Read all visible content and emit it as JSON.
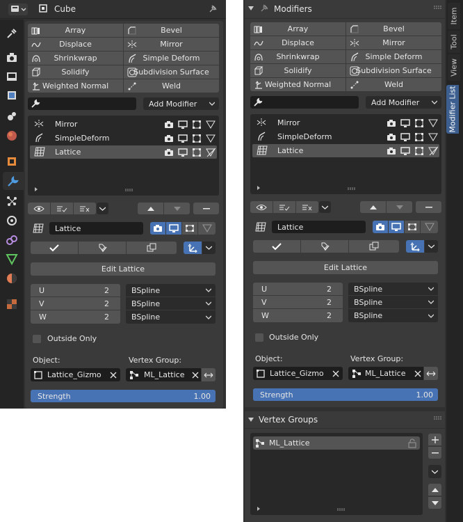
{
  "left": {
    "header_title": "Cube",
    "modifier_buttons": [
      {
        "label": "Array",
        "icon": "array-icon"
      },
      {
        "label": "Bevel",
        "icon": "bevel-icon"
      },
      {
        "label": "Displace",
        "icon": "displace-icon"
      },
      {
        "label": "Mirror",
        "icon": "mirror-icon"
      },
      {
        "label": "Shrinkwrap",
        "icon": "shrinkwrap-icon"
      },
      {
        "label": "Simple Deform",
        "icon": "simple-deform-icon"
      },
      {
        "label": "Solidify",
        "icon": "solidify-icon"
      },
      {
        "label": "Subdivision Surface",
        "icon": "subsurf-icon"
      },
      {
        "label": "Weighted Normal",
        "icon": "weighted-normal-icon"
      },
      {
        "label": "Weld",
        "icon": "weld-icon"
      }
    ],
    "search_value": "",
    "add_modifier": "Add Modifier",
    "stack": [
      "Mirror",
      "SimpleDeform",
      "Lattice"
    ],
    "active_name": "Lattice",
    "edit_lattice": "Edit Lattice",
    "u_label": "U",
    "u_value": "2",
    "u_interp": "BSpline",
    "v_label": "V",
    "v_value": "2",
    "v_interp": "BSpline",
    "w_label": "W",
    "w_value": "2",
    "w_interp": "BSpline",
    "outside_only": "Outside Only",
    "object_label": "Object:",
    "object_value": "Lattice_Gizmo",
    "vgroup_label": "Vertex Group:",
    "vgroup_value": "ML_Lattice",
    "strength_label": "Strength",
    "strength_value": "1.00",
    "strength_fraction": 1.0
  },
  "right": {
    "header_title": "Modifiers",
    "modifier_buttons": [
      {
        "label": "Array",
        "icon": "array-icon"
      },
      {
        "label": "Bevel",
        "icon": "bevel-icon"
      },
      {
        "label": "Displace",
        "icon": "displace-icon"
      },
      {
        "label": "Mirror",
        "icon": "mirror-icon"
      },
      {
        "label": "Shrinkwrap",
        "icon": "shrinkwrap-icon"
      },
      {
        "label": "Simple Deform",
        "icon": "simple-deform-icon"
      },
      {
        "label": "Solidify",
        "icon": "solidify-icon"
      },
      {
        "label": "Subdivision Surface",
        "icon": "subsurf-icon"
      },
      {
        "label": "Weighted Normal",
        "icon": "weighted-normal-icon"
      },
      {
        "label": "Weld",
        "icon": "weld-icon"
      }
    ],
    "search_value": "",
    "add_modifier": "Add Modifier",
    "stack": [
      "Mirror",
      "SimpleDeform",
      "Lattice"
    ],
    "active_name": "Lattice",
    "edit_lattice": "Edit Lattice",
    "u_label": "U",
    "u_value": "2",
    "u_interp": "BSpline",
    "v_label": "V",
    "v_value": "2",
    "v_interp": "BSpline",
    "w_label": "W",
    "w_value": "2",
    "w_interp": "BSpline",
    "outside_only": "Outside Only",
    "object_label": "Object:",
    "object_value": "Lattice_Gizmo",
    "vgroup_label": "Vertex Group:",
    "vgroup_value": "ML_Lattice",
    "strength_label": "Strength",
    "strength_value": "1.00",
    "strength_fraction": 1.0,
    "vertex_groups_title": "Vertex Groups",
    "vertex_groups": [
      "ML_Lattice"
    ]
  },
  "side_tabs": [
    "Item",
    "Tool",
    "View",
    "Modifier List"
  ],
  "properties_tabs": [
    "tool-icon",
    "render-icon",
    "output-icon",
    "view-layer-icon",
    "scene-icon",
    "world-icon",
    "object-icon",
    "modifier-icon",
    "particles-icon",
    "physics-icon",
    "constraints-icon",
    "data-icon",
    "material-icon",
    "texture-icon"
  ],
  "colors": {
    "active_blue": "#4772b3",
    "panel": "#303030",
    "button": "#545454",
    "field": "#1d1d1d",
    "background": "#ffffff"
  }
}
